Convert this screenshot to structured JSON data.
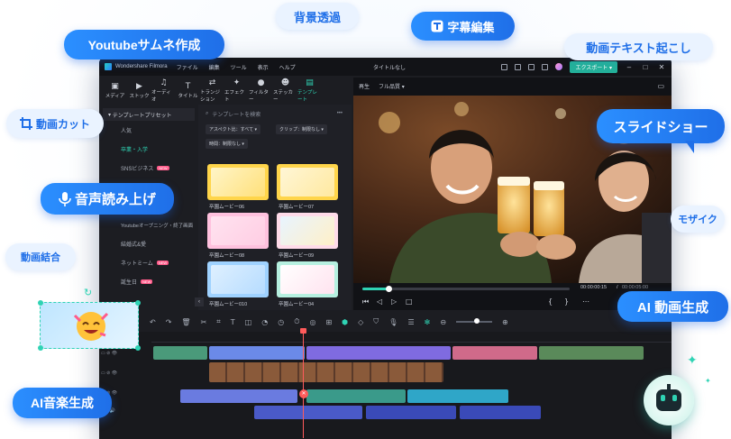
{
  "features": {
    "background_removal": "背景透過",
    "subtitle_edit": "字幕編集",
    "youtube_thumbnail": "Youtubeサムネ作成",
    "motion_text": "動画テキスト起こし",
    "video_cut": "動画カット",
    "slideshow": "スライドショー",
    "voice_reading": "音声読み上げ",
    "mosaic": "モザイク",
    "video_merge": "動画結合",
    "ai_video": "AI 動画生成",
    "ai_music": "AI音楽生成"
  },
  "app": {
    "name": "Wondershare Filmora",
    "menu": [
      "ファイル",
      "編集",
      "ツール",
      "表示",
      "ヘルプ"
    ],
    "project_title": "タイトルなし",
    "export_label": "エクスポート"
  },
  "toolbar": {
    "items": [
      {
        "label": "メディア",
        "icon": "media-icon"
      },
      {
        "label": "ストック",
        "icon": "stock-icon"
      },
      {
        "label": "オーディオ",
        "icon": "audio-icon"
      },
      {
        "label": "タイトル",
        "icon": "title-icon"
      },
      {
        "label": "トランジション",
        "icon": "transition-icon"
      },
      {
        "label": "エフェクト",
        "icon": "effect-icon"
      },
      {
        "label": "フィルター",
        "icon": "filter-icon"
      },
      {
        "label": "ステッカー",
        "icon": "sticker-icon"
      },
      {
        "label": "テンプレート",
        "icon": "template-icon"
      }
    ],
    "active_index": 8
  },
  "template_nav": {
    "header": "テンプレートプリセット",
    "items": [
      {
        "label": "人気",
        "badge": ""
      },
      {
        "label": "卒業・入学",
        "badge": ""
      },
      {
        "label": "SNSビジネス",
        "badge": "NEW"
      },
      {
        "label": "",
        "badge": ""
      },
      {
        "label": "",
        "badge": ""
      },
      {
        "label": "Youtubeオープニング・終了画面",
        "badge": ""
      },
      {
        "label": "結婚式&愛",
        "badge": ""
      },
      {
        "label": "ネットミーム",
        "badge": "NEW"
      },
      {
        "label": "誕生日",
        "badge": "NEW"
      }
    ],
    "active_index": 1
  },
  "template_panel": {
    "search_placeholder": "テンプレートを検索",
    "filters": [
      "アスペクト比：すべて",
      "クリップ：制限なし",
      "時間：制限なし"
    ],
    "thumbnails": [
      "卒園ムービー06",
      "卒園ムービー07",
      "卒園ムービー08",
      "卒園ムービー09",
      "卒園ムービー010",
      "卒園ムービー04"
    ]
  },
  "player": {
    "mode_label": "再生",
    "quality_label": "フル品質",
    "current_time": "00:00:00:15",
    "total_time": "00:00:05:00",
    "progress": 0.13
  },
  "colors": {
    "accent": "#2fd3b4",
    "pill_blue": "#1f6fe8",
    "playhead": "#ff5b5b"
  }
}
